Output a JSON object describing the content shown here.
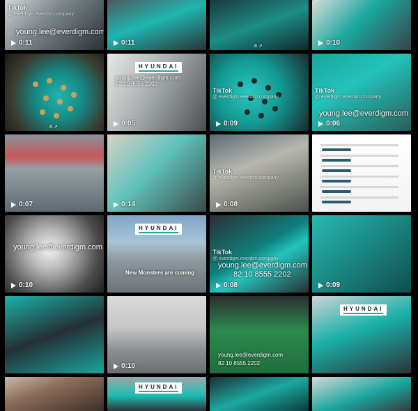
{
  "tiles": [
    {
      "row": 0,
      "col": 0,
      "duration": "0:11",
      "overlay": "young.lee@everdigm.com",
      "tiktok": "TikTok",
      "handle": "@ everdigm.everdim.company"
    },
    {
      "row": 0,
      "col": 1,
      "duration": "0:11"
    },
    {
      "row": 0,
      "col": 2,
      "caption": "8 ↗"
    },
    {
      "row": 0,
      "col": 3,
      "duration": "0:10"
    },
    {
      "row": 1,
      "col": 0,
      "caption": "8 ↗"
    },
    {
      "row": 1,
      "col": 1,
      "duration": "0:05",
      "logo": "HYUNDAI",
      "overlay": "young.lee@everdigm.com",
      "overlay2": "82 10 8555 2202"
    },
    {
      "row": 1,
      "col": 2,
      "duration": "0:09",
      "tiktok": "TikTok",
      "handle": "@ everdigm.everdim.company"
    },
    {
      "row": 1,
      "col": 3,
      "duration": "0:06",
      "tiktok": "TikTok",
      "handle": "@ everdigm.everdim.company",
      "overlay": "young.lee@everdigm.com"
    },
    {
      "row": 2,
      "col": 0,
      "duration": "0:07"
    },
    {
      "row": 2,
      "col": 1,
      "duration": "0:14"
    },
    {
      "row": 2,
      "col": 2,
      "duration": "0:08",
      "tiktok": "TikTok",
      "handle": "@ everdigm.everdim.company"
    },
    {
      "row": 2,
      "col": 3
    },
    {
      "row": 3,
      "col": 0,
      "duration": "0:10",
      "overlay": "young.lee@everdigm.com"
    },
    {
      "row": 3,
      "col": 1,
      "logo": "HYUNDAI",
      "overlay": "New Monsters are coming"
    },
    {
      "row": 3,
      "col": 2,
      "duration": "0:08",
      "tiktok": "TikTok",
      "handle": "@ everdigm.everdim.company",
      "overlay": "young.lee@everdigm.com",
      "overlay2": "82 10 8555 2202"
    },
    {
      "row": 3,
      "col": 3,
      "duration": "0:09"
    },
    {
      "row": 4,
      "col": 0
    },
    {
      "row": 4,
      "col": 1,
      "duration": "0:10"
    },
    {
      "row": 4,
      "col": 2,
      "overlay": "young.lee@everdigm.com",
      "overlay2": "82 10 8555 2202"
    },
    {
      "row": 4,
      "col": 3,
      "logo": "HYUNDAI"
    },
    {
      "row": 5,
      "col": 0
    },
    {
      "row": 5,
      "col": 1,
      "logo": "HYUNDAI"
    },
    {
      "row": 5,
      "col": 2
    },
    {
      "row": 5,
      "col": 3
    }
  ],
  "colors": {
    "teal": "#1ec8c0",
    "dark": "#1b1f22",
    "steel": "#9aa3a8"
  }
}
